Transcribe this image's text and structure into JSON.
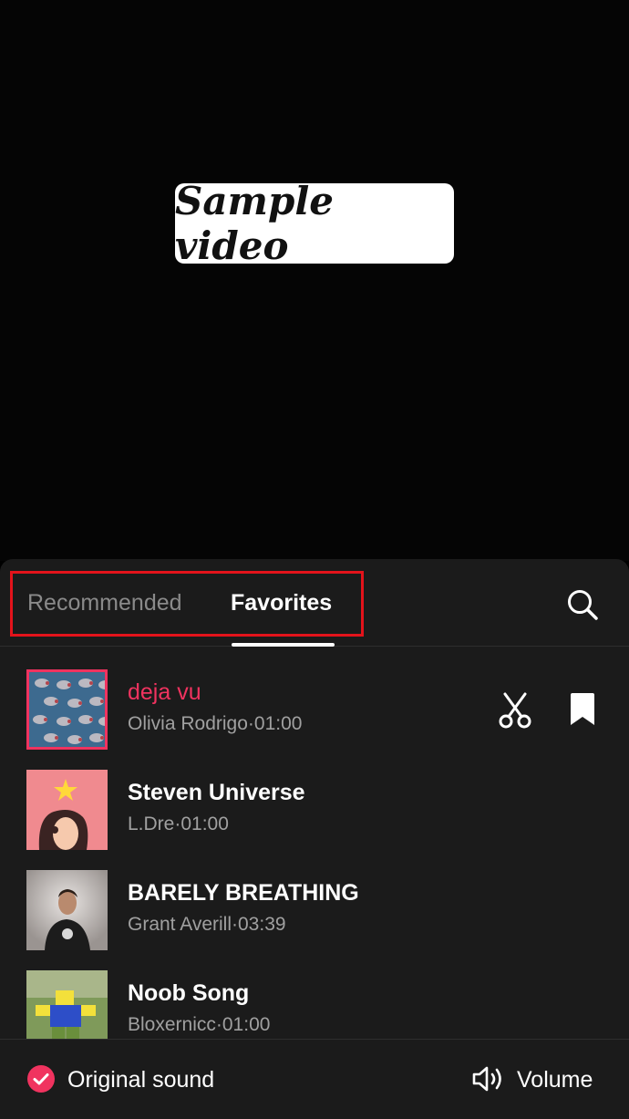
{
  "video": {
    "overlay_text": "Sample video"
  },
  "tabs": [
    {
      "label": "Recommended",
      "selected": false
    },
    {
      "label": "Favorites",
      "selected": true
    }
  ],
  "search": {
    "icon": "search-icon"
  },
  "tracks": [
    {
      "title": "deja vu",
      "artist": "Olivia Rodrigo",
      "duration": "01:00",
      "active": true
    },
    {
      "title": "Steven Universe",
      "artist": "L.Dre",
      "duration": "01:00",
      "active": false
    },
    {
      "title": "BARELY BREATHING",
      "artist": "Grant Averill",
      "duration": "03:39",
      "active": false
    },
    {
      "title": "Noob Song",
      "artist": "Bloxernicc",
      "duration": "01:00",
      "active": false
    }
  ],
  "track_sep": "·",
  "actions": {
    "trim_icon": "scissors-icon",
    "favorite_icon": "bookmark-icon"
  },
  "footer": {
    "original_sound_label": "Original sound",
    "original_sound_checked": true,
    "volume_label": "Volume"
  },
  "colors": {
    "accent": "#f0335f",
    "highlight_box": "#e3131b",
    "sheet_bg": "#1b1b1b",
    "muted_text": "#a0a0a0"
  }
}
